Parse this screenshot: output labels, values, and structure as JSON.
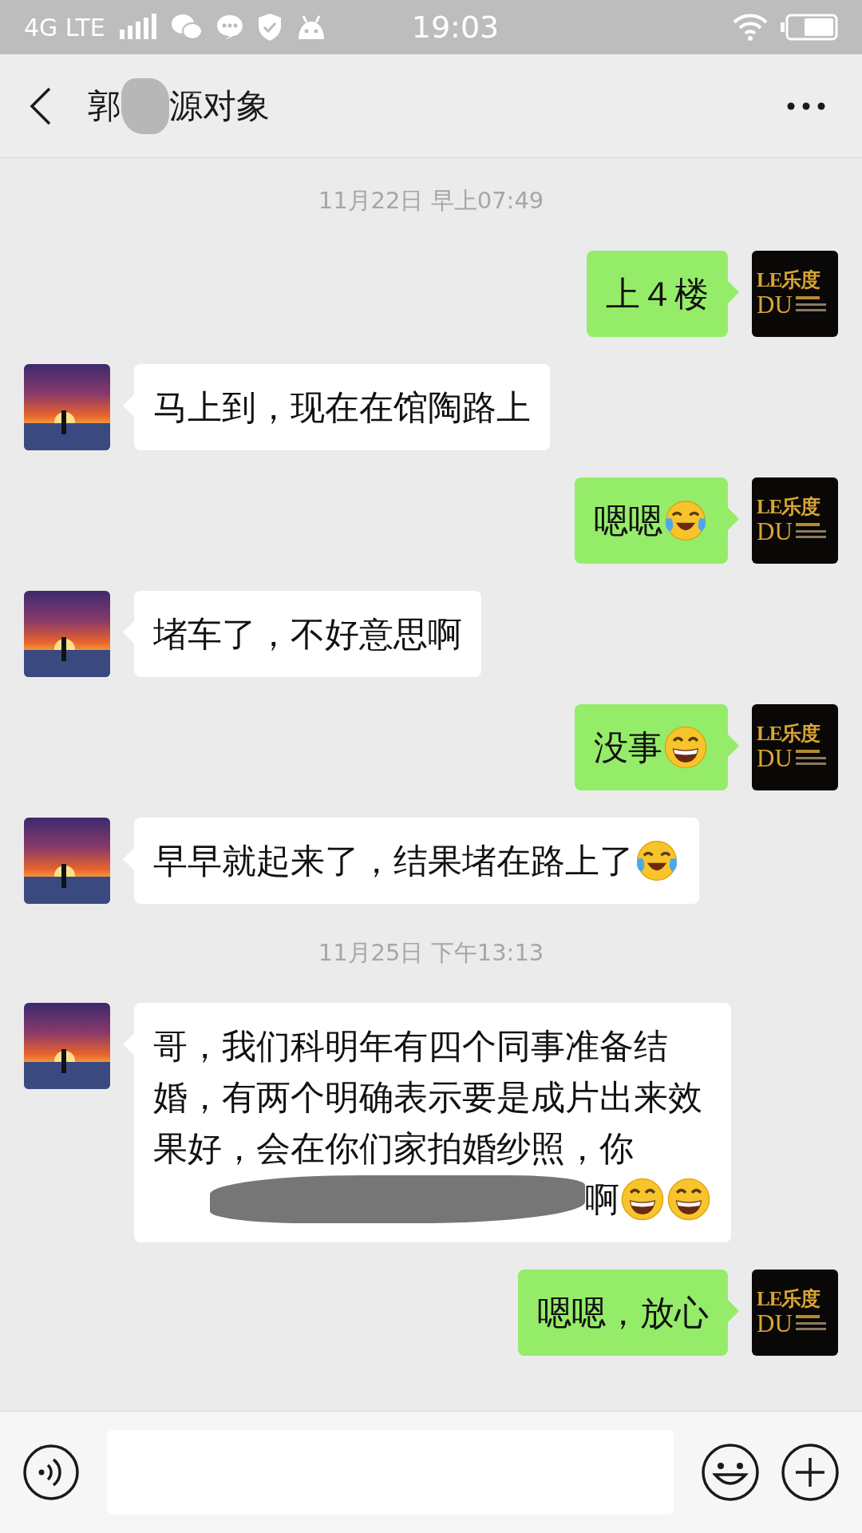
{
  "status_bar": {
    "network": "4G LTE",
    "time": "19:03"
  },
  "header": {
    "title_parts": [
      "郭",
      "源对象"
    ]
  },
  "messages": [
    {
      "kind": "time",
      "text": "11月22日 早上07:49"
    },
    {
      "kind": "me",
      "text": "上４楼",
      "avatar_text": [
        "LE乐度",
        "DU"
      ]
    },
    {
      "kind": "them",
      "text": "马上到，现在在馆陶路上"
    },
    {
      "kind": "me",
      "text": "嗯嗯",
      "emojis": [
        {
          "kind": "tears"
        }
      ],
      "avatar_text": [
        "LE乐度",
        "DU"
      ]
    },
    {
      "kind": "them",
      "text": "堵车了，不好意思啊"
    },
    {
      "kind": "me",
      "text": "没事",
      "emojis": [
        {
          "kind": "grin"
        }
      ],
      "avatar_text": [
        "LE乐度",
        "DU"
      ]
    },
    {
      "kind": "them",
      "text": "早早就起来了，结果堵在路上了",
      "emojis": [
        {
          "kind": "tears"
        }
      ]
    },
    {
      "kind": "time",
      "text": "11月25日 下午13:13"
    },
    {
      "kind": "them",
      "text": "哥，我们科明年有四个同事准备结婚，有两个明确表示要是成片出来效果好，会在你们家拍婚纱照，你",
      "redacted_tail": "啊",
      "emojis": [
        {
          "kind": "grin"
        },
        {
          "kind": "grin"
        }
      ]
    },
    {
      "kind": "me",
      "text": "嗯嗯，放心",
      "avatar_text": [
        "LE乐度",
        "DU"
      ]
    }
  ]
}
